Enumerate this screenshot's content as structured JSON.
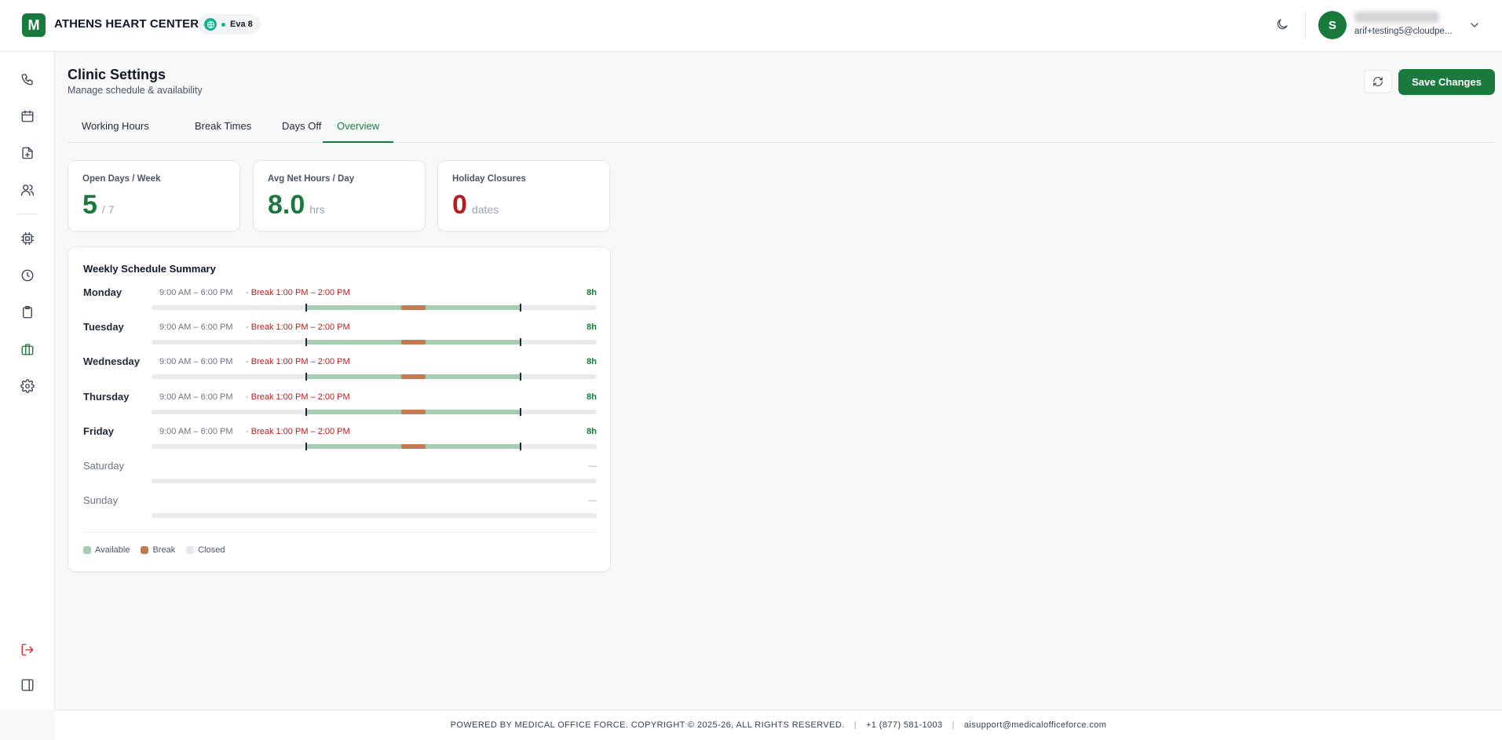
{
  "brand": {
    "logo_letter": "M",
    "name": "ATHENS HEART CENTER"
  },
  "assistant": {
    "label": "Eva 8"
  },
  "user": {
    "avatar_letter": "S",
    "email": "arif+testing5@cloudpe..."
  },
  "page": {
    "title": "Clinic Settings",
    "subtitle": "Manage schedule & availability"
  },
  "actions": {
    "save_label": "Save Changes"
  },
  "tabs": [
    {
      "label": "Working Hours",
      "active": false
    },
    {
      "label": "Break Times",
      "active": false
    },
    {
      "label": "Days Off",
      "active": false
    },
    {
      "label": "Overview",
      "active": true
    }
  ],
  "stats": [
    {
      "label": "Open Days / Week",
      "value": "5",
      "unit": "/ 7"
    },
    {
      "label": "Avg Net Hours / Day",
      "value": "8.0",
      "unit": "hrs"
    },
    {
      "label": "Holiday Closures",
      "value": "0",
      "unit": "dates"
    }
  ],
  "weekly": {
    "title": "Weekly Schedule Summary",
    "days": [
      {
        "name": "Monday",
        "hours": "9:00 AM – 6:00 PM",
        "break": "· Break 1:00 PM – 2:00 PM",
        "total": "8h",
        "open": true
      },
      {
        "name": "Tuesday",
        "hours": "9:00 AM – 6:00 PM",
        "break": "· Break 1:00 PM – 2:00 PM",
        "total": "8h",
        "open": true
      },
      {
        "name": "Wednesday",
        "hours": "9:00 AM – 6:00 PM",
        "break": "· Break 1:00 PM – 2:00 PM",
        "total": "8h",
        "open": true
      },
      {
        "name": "Thursday",
        "hours": "9:00 AM – 6:00 PM",
        "break": "· Break 1:00 PM – 2:00 PM",
        "total": "8h",
        "open": true
      },
      {
        "name": "Friday",
        "hours": "9:00 AM – 6:00 PM",
        "break": "· Break 1:00 PM – 2:00 PM",
        "total": "8h",
        "open": true
      },
      {
        "name": "Saturday",
        "hours": "",
        "break": "",
        "total": "—",
        "open": false
      },
      {
        "name": "Sunday",
        "hours": "",
        "break": "",
        "total": "—",
        "open": false
      }
    ],
    "legend": [
      {
        "label": "Available",
        "color": "#a8cdb5"
      },
      {
        "label": "Break",
        "color": "#c47a52"
      },
      {
        "label": "Closed",
        "color": "#e5e7eb"
      }
    ]
  },
  "footer": {
    "copyright": "POWERED BY MEDICAL OFFICE FORCE. COPYRIGHT © 2025-26, ALL RIGHTS RESERVED.",
    "phone": "+1 (877) 581-1003",
    "email": "aisupport@medicalofficeforce.com"
  },
  "colors": {
    "brand": "#1a7a3e",
    "danger": "#b91c1c",
    "available": "#a8cdb5",
    "break": "#c47a52"
  },
  "icons": {
    "sidebar": [
      "phone-icon",
      "calendar-icon",
      "file-plus-icon",
      "users-icon",
      "cpu-icon",
      "clock-icon",
      "clipboard-icon",
      "briefcase-icon",
      "settings-icon"
    ],
    "bottom": [
      "logout-icon",
      "sidebar-toggle-icon"
    ]
  }
}
